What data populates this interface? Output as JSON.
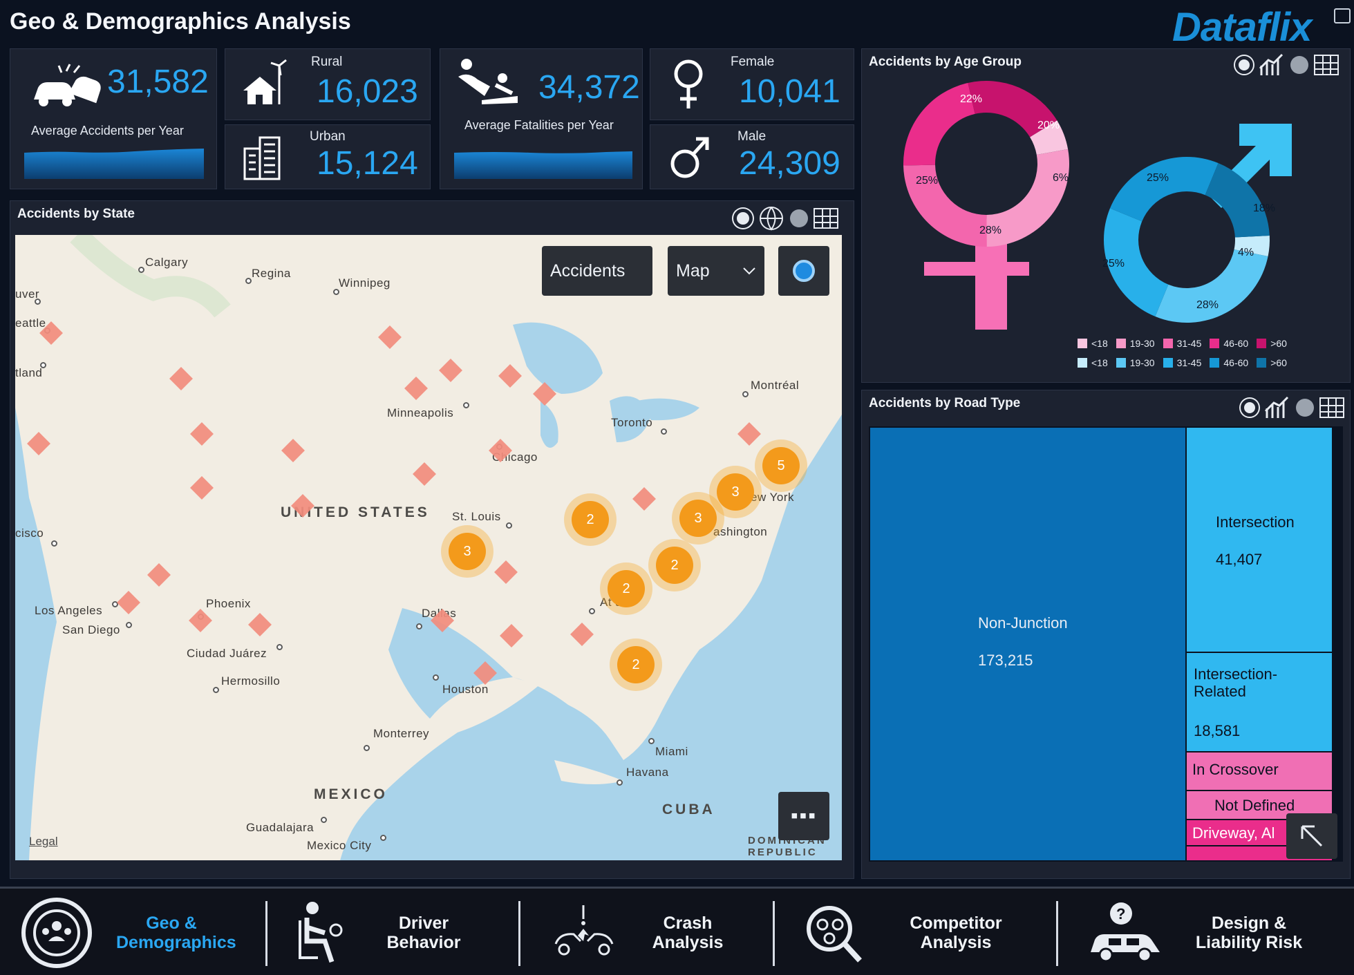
{
  "header": {
    "title": "Geo & Demographics Analysis",
    "brand": "Dataflix"
  },
  "kpis": {
    "avg_accidents": {
      "value": "31,582",
      "label": "Average Accidents per Year"
    },
    "rural": {
      "label": "Rural",
      "value": "16,023"
    },
    "urban": {
      "label": "Urban",
      "value": "15,124"
    },
    "avg_fatalities": {
      "value": "34,372",
      "label": "Average Fatalities per Year"
    },
    "female": {
      "label": "Female",
      "value": "10,041"
    },
    "male": {
      "label": "Male",
      "value": "24,309"
    }
  },
  "map_panel": {
    "title": "Accidents by State",
    "controls": {
      "metric": "Accidents",
      "view": "Map"
    },
    "legal": "Legal",
    "cities": [
      "Calgary",
      "Regina",
      "Winnipeg",
      "Vancouver",
      "Seattle",
      "Portland",
      "Minneapolis",
      "Toronto",
      "Montréal",
      "Chicago",
      "New York",
      "Washington",
      "St. Louis",
      "San Francisco",
      "Los Angeles",
      "San Diego",
      "Phoenix",
      "Dallas",
      "Atlanta",
      "Ciudad Juárez",
      "Hermosillo",
      "Houston",
      "Monterrey",
      "Miami",
      "Havana",
      "Guadalajara",
      "Mexico City"
    ],
    "city_labels": {
      "calgary": "Calgary",
      "regina": "Regina",
      "winnipeg": "Winnipeg",
      "vancouver": "uver",
      "seattle": "eattle",
      "portland": "tland",
      "minneapolis": "Minneapolis",
      "toronto": "Toronto",
      "montreal": "Montréal",
      "chicago": "Chicago",
      "newyork": "ew York",
      "washington": "ashington",
      "stlouis": "St. Louis",
      "sanfrancisco": "cisco",
      "losangeles": "Los Angeles",
      "sandiego": "San Diego",
      "phoenix": "Phoenix",
      "dallas": "Dallas",
      "atlanta": "At     a",
      "ciudadjuarez": "Ciudad Juárez",
      "hermosillo": "Hermosillo",
      "houston": "Houston",
      "monterrey": "Monterrey",
      "miami": "Miami",
      "havana": "Havana",
      "guadalajara": "Guadalajara",
      "mexicocity": "Mexico City"
    },
    "countries": {
      "us": "UNITED STATES",
      "mexico": "MEXICO",
      "cuba": "CUBA",
      "dominican": "DOMINICAN REPUBLIC"
    },
    "clusters": [
      {
        "name": "new-york",
        "count": "5"
      },
      {
        "name": "mid-atlantic",
        "count": "3"
      },
      {
        "name": "washington",
        "count": "3"
      },
      {
        "name": "ohio",
        "count": "2"
      },
      {
        "name": "missouri",
        "count": "3"
      },
      {
        "name": "carolina",
        "count": "2"
      },
      {
        "name": "atlanta",
        "count": "2"
      },
      {
        "name": "florida",
        "count": "2"
      }
    ]
  },
  "age_panel": {
    "title": "Accidents by Age Group",
    "legend_female": [
      "<18",
      "19-30",
      "31-45",
      "46-60",
      ">60"
    ],
    "legend_male": [
      "<18",
      "19-30",
      "31-45",
      "46-60",
      ">60"
    ],
    "female_colors": [
      "#f9c6e0",
      "#f79ac8",
      "#f366ad",
      "#ea2d8b",
      "#c7136d"
    ],
    "male_colors": [
      "#c6ecfb",
      "#5cc8f4",
      "#28b0ea",
      "#1698d6",
      "#0f74a8"
    ],
    "female_pcts": {
      "a": "22%",
      "b": "20%",
      "c": "6%",
      "d": "28%",
      "e": "25%"
    },
    "male_pcts": {
      "a": "25%",
      "b": "18%",
      "c": "4%",
      "d": "28%",
      "e": "25%"
    },
    "chart_data": {
      "type": "pie",
      "series": [
        {
          "name": "Female",
          "labels": [
            "<18",
            "19-30",
            "31-45",
            "46-60",
            ">60"
          ],
          "values": [
            6,
            28,
            25,
            22,
            20
          ]
        },
        {
          "name": "Male",
          "labels": [
            "<18",
            "19-30",
            "31-45",
            "46-60",
            ">60"
          ],
          "values": [
            4,
            28,
            25,
            25,
            18
          ]
        }
      ]
    }
  },
  "road_panel": {
    "title": "Accidents by Road Type",
    "cells": [
      {
        "label": "Non-Junction",
        "value": "173,215"
      },
      {
        "label": "Intersection",
        "value": "41,407"
      },
      {
        "label": "Intersection-Related",
        "value": "18,581"
      },
      {
        "label": "In Crossover",
        "value": ""
      },
      {
        "label": "Not Defined",
        "value": ""
      },
      {
        "label": "Driveway, Al",
        "value": ""
      }
    ],
    "chart_data": {
      "type": "treemap",
      "categories": [
        "Non-Junction",
        "Intersection",
        "Intersection-Related"
      ],
      "values": [
        173215,
        41407,
        18581
      ]
    }
  },
  "nav": [
    {
      "label": "Geo & Demographics",
      "active": true
    },
    {
      "label": "Driver Behavior",
      "active": false
    },
    {
      "label": "Crash Analysis",
      "active": false
    },
    {
      "label": "Competitor Analysis",
      "active": false
    },
    {
      "label": "Design & Liability Risk",
      "active": false
    }
  ],
  "colors": {
    "accent": "#2aa7f2",
    "background": "#0b1220",
    "panel": "#1c2230",
    "cluster": "#f39a1b",
    "marker": "#f28c7d"
  }
}
